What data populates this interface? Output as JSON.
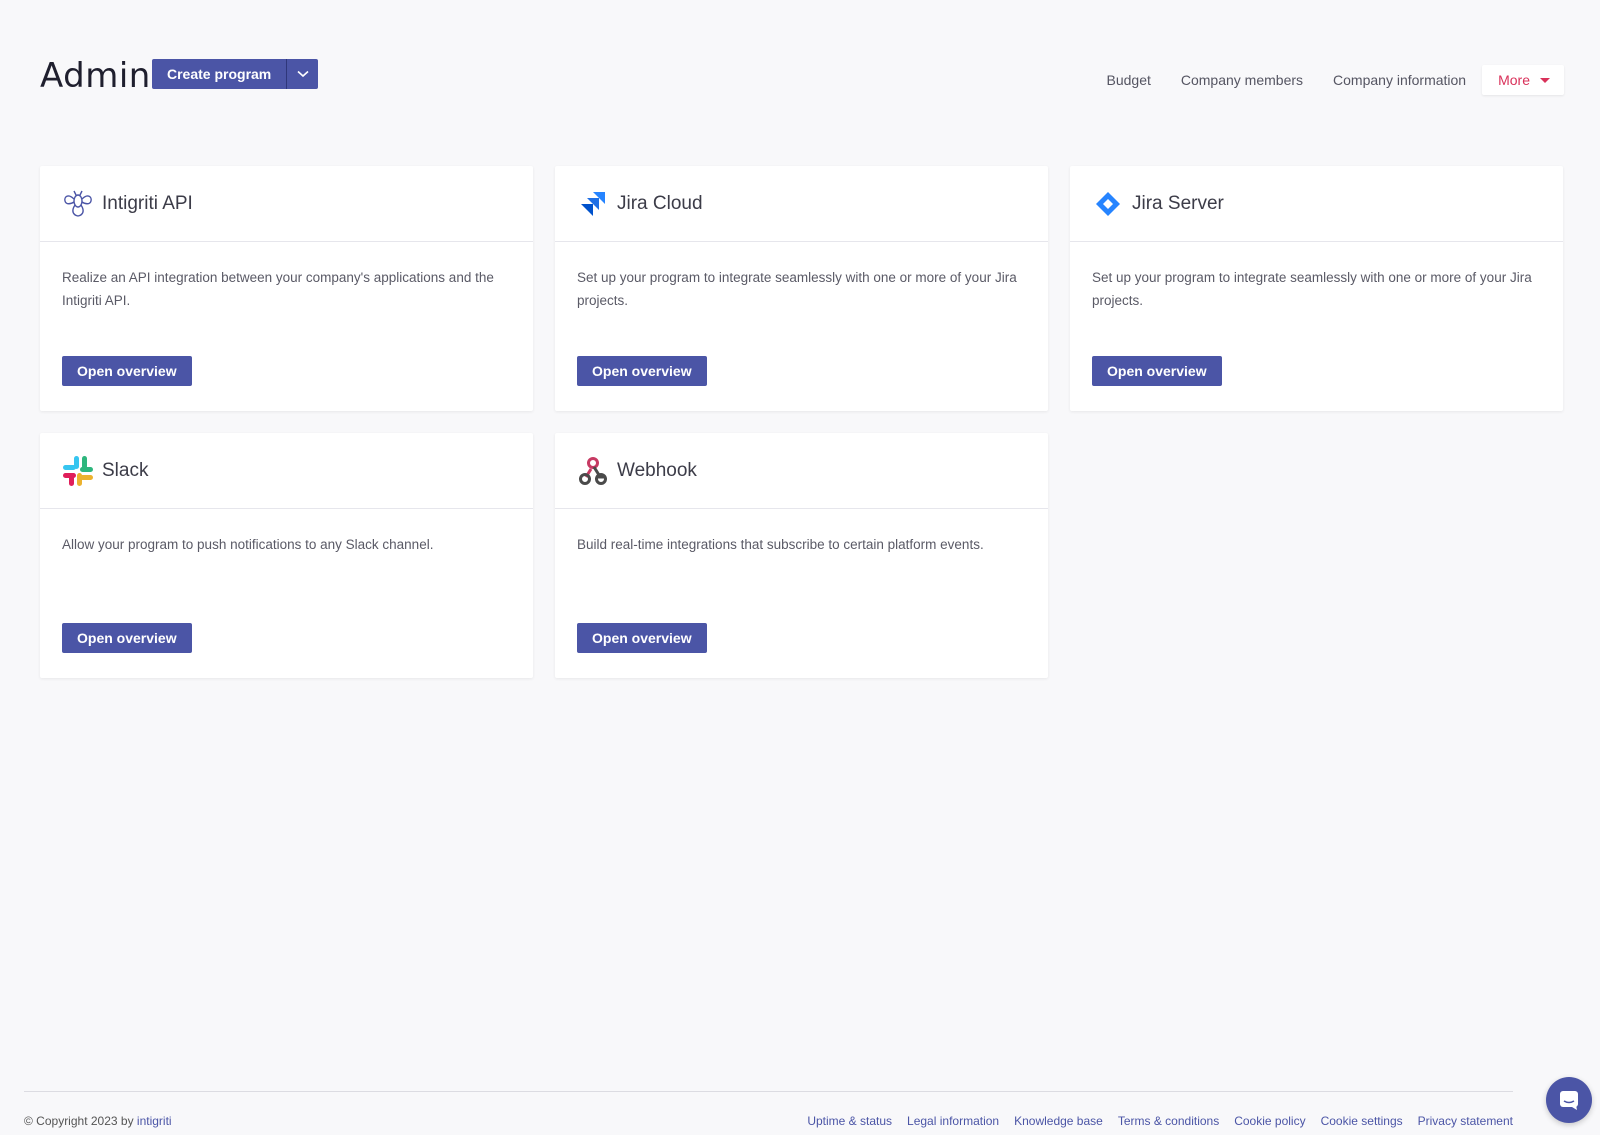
{
  "header": {
    "title": "Admin",
    "create_label": "Create program",
    "nav": {
      "budget": "Budget",
      "members": "Company members",
      "info": "Company information",
      "more": "More"
    }
  },
  "cards": [
    {
      "title": "Intigriti API",
      "desc": "Realize an API integration between your company's applications and the Intigriti API.",
      "button": "Open overview"
    },
    {
      "title": "Jira Cloud",
      "desc": "Set up your program to integrate seamlessly with one or more of your Jira projects.",
      "button": "Open overview"
    },
    {
      "title": "Jira Server",
      "desc": "Set up your program to integrate seamlessly with one or more of your Jira projects.",
      "button": "Open overview"
    },
    {
      "title": "Slack",
      "desc": "Allow your program to push notifications to any Slack channel.",
      "button": "Open overview"
    },
    {
      "title": "Webhook",
      "desc": "Build real-time integrations that subscribe to certain platform events.",
      "button": "Open overview"
    }
  ],
  "footer": {
    "copyright": "© Copyright 2023 by",
    "brand": "intigriti",
    "links": [
      "Uptime & status",
      "Legal information",
      "Knowledge base",
      "Terms & conditions",
      "Cookie policy",
      "Cookie settings",
      "Privacy statement"
    ]
  },
  "colors": {
    "primary": "#4b55a6",
    "accent": "#d9315a",
    "background": "#f8f8fa"
  },
  "icons": [
    "intigriti-logo-icon",
    "jira-cloud-icon",
    "jira-server-icon",
    "slack-icon",
    "webhook-icon",
    "chevron-down-icon",
    "chat-icon"
  ]
}
